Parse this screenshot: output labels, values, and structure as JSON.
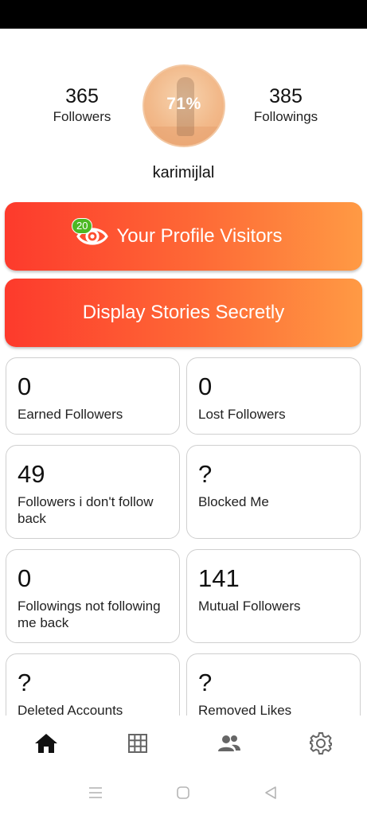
{
  "profile": {
    "followers_count": "365",
    "followers_label": "Followers",
    "followings_count": "385",
    "followings_label": "Followings",
    "progress_text": "71%",
    "progress_value": 0.71,
    "username": "karimijlal"
  },
  "actions": {
    "visitors_label": "Your Profile Visitors",
    "visitors_badge": "20",
    "stories_label": "Display Stories Secretly"
  },
  "cards": [
    {
      "value": "0",
      "label": "Earned Followers"
    },
    {
      "value": "0",
      "label": "Lost Followers"
    },
    {
      "value": "49",
      "label": "Followers i don't follow back"
    },
    {
      "value": "?",
      "label": "Blocked Me"
    },
    {
      "value": "0",
      "label": "Followings not following me back"
    },
    {
      "value": "141",
      "label": "Mutual Followers"
    },
    {
      "value": "?",
      "label": "Deleted Accounts"
    },
    {
      "value": "?",
      "label": "Removed Likes"
    }
  ],
  "bottom_nav": [
    {
      "icon": "home-icon",
      "active": true
    },
    {
      "icon": "grid-icon",
      "active": false
    },
    {
      "icon": "people-icon",
      "active": false
    },
    {
      "icon": "settings-icon",
      "active": false
    }
  ],
  "system_nav": [
    "menu-icon",
    "home-circle-icon",
    "back-icon"
  ],
  "colors": {
    "cta_gradient_start": "#fd3a2c",
    "cta_gradient_end": "#ff9a44",
    "badge_green": "#4cb824",
    "card_border": "#cfcfcf"
  }
}
